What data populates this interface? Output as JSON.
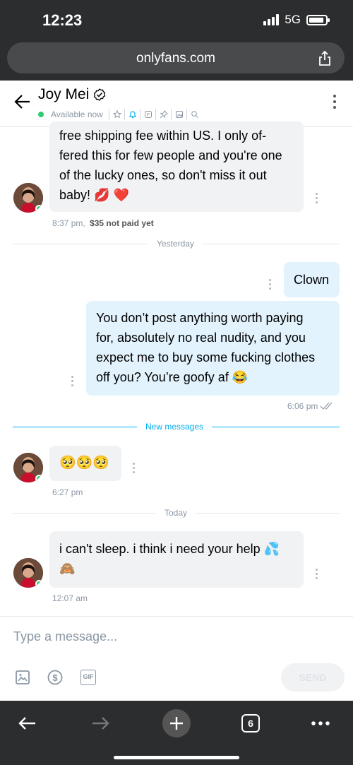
{
  "status_bar": {
    "time": "12:23",
    "network": "5G"
  },
  "browser": {
    "url": "onlyfans.com"
  },
  "header": {
    "name": "Joy Mei",
    "availability": "Available now"
  },
  "messages": {
    "m1": {
      "lines": [
        "free shipping fee within US. I only of-",
        "fered this for few people and you're one",
        "of the lucky ones, so don't miss it out",
        "baby! 💋 ❤️"
      ],
      "time": "8:37 pm,",
      "price": "$35 not paid yet"
    },
    "div_yesterday": "Yesterday",
    "m2": {
      "text": "Clown"
    },
    "m3": {
      "lines": [
        "You don’t post anything worth paying",
        "for, absolutely no real nudity, and you",
        "expect me to buy some fucking clothes",
        "off you? You’re goofy af 😂"
      ],
      "time": "6:06 pm"
    },
    "div_new": "New messages",
    "m4": {
      "text": "🥺🥺🥺",
      "time": "6:27 pm"
    },
    "div_today": "Today",
    "m5": {
      "lines": [
        "i can't sleep. i think i need your help 💦",
        "🙈"
      ],
      "time": "12:07 am"
    }
  },
  "composer": {
    "placeholder": "Type a message...",
    "send_label": "SEND",
    "gif_label": "GIF"
  },
  "nav": {
    "tab_count": "6"
  },
  "colors": {
    "accent": "#00aff0",
    "online": "#2ecc71",
    "incoming_bubble": "#f0f2f4",
    "outgoing_bubble": "#e2f3fd"
  }
}
